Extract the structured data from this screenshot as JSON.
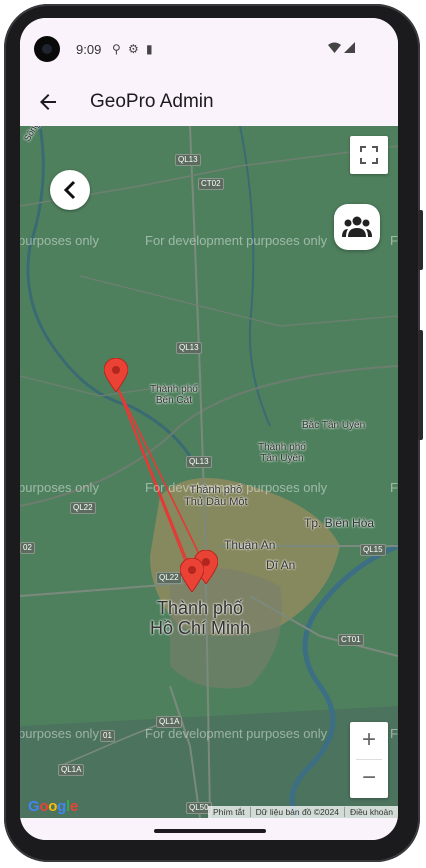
{
  "status": {
    "time": "9:09"
  },
  "appbar": {
    "title": "GeoPro Admin"
  },
  "map": {
    "watermark_text": "For development purposes only",
    "watermark_fragments": [
      "purposes only",
      "purposes only",
      "purposes only",
      "Fo",
      "Fo",
      "Fo"
    ],
    "places": {
      "ben_cat": "Thành phố\nBến Cát",
      "bac_tan_uyen": "Bắc Tân Uyên",
      "tan_uyen": "Thành phố\nTân Uyên",
      "thu_dau_mot": "Thành phố\nThủ Dầu Một",
      "bien_hoa": "Tp. Biên Hòa",
      "thuan_an": "Thuận An",
      "di_an": "Dĩ An",
      "hcm": "Thành phố\nHồ Chí Minh",
      "song_sai_gon": "Sông Sài Gòn"
    },
    "roads": [
      "QL13",
      "CT02",
      "QL13",
      "QL13",
      "QL22",
      "02",
      "QL15",
      "QL22",
      "CT01",
      "QL1A",
      "QL1A",
      "01",
      "QL50"
    ],
    "markers_count": 3,
    "google_logo": "Google",
    "attribution": [
      "Phím tắt",
      "Dữ liệu bản đồ ©2024",
      "Điều khoản"
    ],
    "zoom_in": "+",
    "zoom_out": "−"
  },
  "colors": {
    "marker": "#ea4335",
    "route": "#e53935",
    "map_green": "#4e7f5d",
    "urban": "#9c8a5a"
  }
}
